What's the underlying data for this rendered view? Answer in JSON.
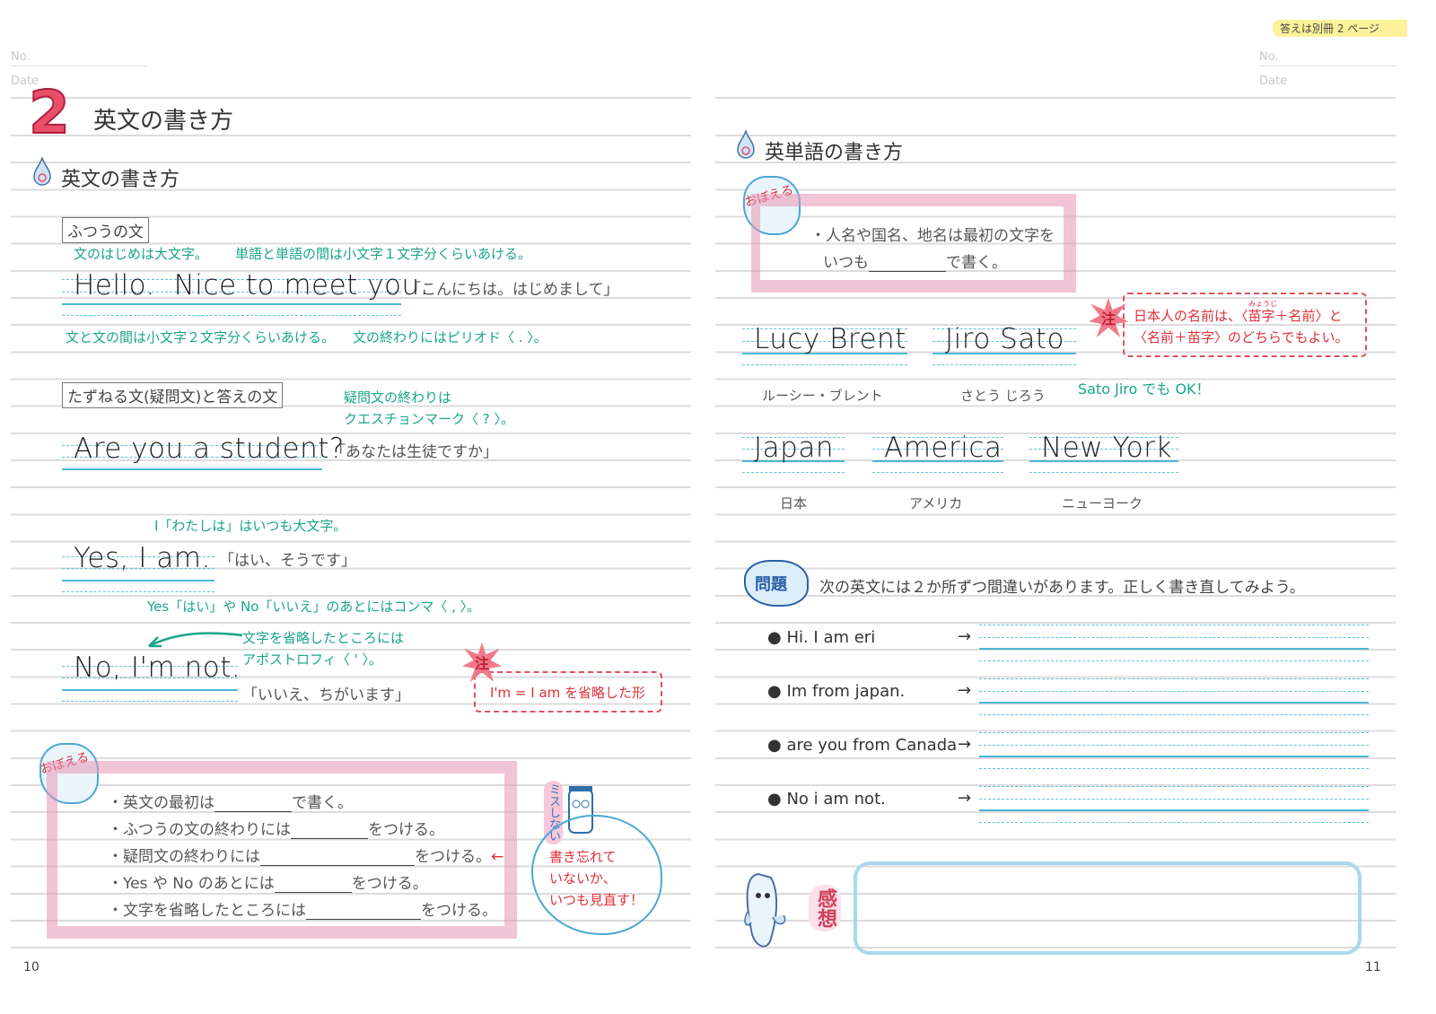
{
  "header": {
    "answer_note": "答えは別冊 2 ページ",
    "no_label": "No.",
    "date_label": "Date"
  },
  "left": {
    "chapter_number": "2",
    "chapter_title": "英文の書き方",
    "section_title": "英文の書き方",
    "normal": {
      "label": "ふつうの文",
      "note_capital": "文のはじめは大文字。",
      "note_word_space": "単語と単語の間は小文字１文字分くらいあける。",
      "sentence": "Hello.  Nice to meet you.",
      "translation": "「こんにちは。はじめまして」",
      "note_sentence_space": "文と文の間は小文字２文字分くらいあける。",
      "note_period": "文の終わりにはピリオド〈 . 〉。"
    },
    "question": {
      "label": "たずねる文(疑問文)と答えの文",
      "note_qmark_1": "疑問文の終わりは",
      "note_qmark_2": "クエスチョンマーク〈 ? 〉。",
      "sentence": "Are you a student?",
      "translation": "「あなたは生徒ですか」",
      "note_i": "I「わたしは」はいつも大文字。",
      "yes_sentence": "Yes, I am.",
      "yes_translation": "「はい、そうです」",
      "note_comma": "Yes「はい」や No「いいえ」のあとにはコンマ〈 , 〉。",
      "note_apos_1": "文字を省略したところには",
      "note_apos_2": "アポストロフィ〈 ' 〉。",
      "no_sentence": "No, I'm not.",
      "no_translation": "「いいえ、ちがいます」",
      "caution_badge": "注",
      "caution_text": "I'm = I am を省略した形"
    },
    "remember": {
      "badge": "おぼえる",
      "items": [
        {
          "before": "・英文の最初は",
          "after": "で書く。"
        },
        {
          "before": "・ふつうの文の終わりには",
          "after": "をつける。"
        },
        {
          "before": "・疑問文の終わりには",
          "after": "をつける。"
        },
        {
          "before": "・Yes や No のあとには",
          "after": "をつける。"
        },
        {
          "before": "・文字を省略したところには",
          "after": "をつける。"
        }
      ],
      "mascot_label": "ミスしない",
      "bubble": [
        "書き忘れて",
        "いないか、",
        "いつも見直す！"
      ]
    },
    "page_number": "10"
  },
  "right": {
    "section_title": "英単語の書き方",
    "remember": {
      "badge": "おぼえる",
      "line1": "・人名や国名、地名は最初の文字を",
      "line2_before": "いつも",
      "line2_after": "で書く。"
    },
    "names": [
      {
        "word": "Lucy Brent",
        "reading": "ルーシー・ブレント"
      },
      {
        "word": "Jiro Sato",
        "reading": "さとう じろう"
      }
    ],
    "caution_badge": "注",
    "caution_line1": "日本人の名前は、〈苗字＋名前〉と",
    "caution_ruby": "みょうじ",
    "caution_line2": "〈名前＋苗字〉のどちらでもよい。",
    "sato_note": "Sato Jiro でも OK！",
    "places": [
      {
        "word": "Japan",
        "reading": "日本"
      },
      {
        "word": "America",
        "reading": "アメリカ"
      },
      {
        "word": "New York",
        "reading": "ニューヨーク"
      }
    ],
    "problem": {
      "badge": "問題",
      "instruction": "次の英文には２か所ずつ間違いがあります。正しく書き直してみよう。",
      "items": [
        "Hi.  I am eri",
        "Im from japan.",
        "are you from Canada",
        "No i am not."
      ],
      "arrow": "→"
    },
    "impression_label": "感想",
    "page_number": "11"
  },
  "colors": {
    "accent_green": "#1aa58a",
    "guide_blue": "#4bb8d4",
    "pink": "#e896b4",
    "red": "#e0303a",
    "note_yellow": "#fdf29a"
  }
}
